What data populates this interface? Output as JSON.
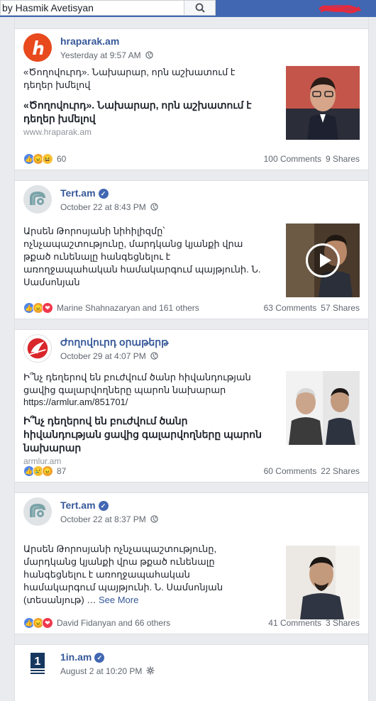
{
  "search": {
    "value": "by Hasmik Avetisyan"
  },
  "icons": {
    "search": "search-icon",
    "globe": "globe-icon",
    "gear": "gear-icon",
    "verified": "verified-check-icon",
    "play": "play-icon"
  },
  "colors": {
    "brand_blue": "#4267b2",
    "link": "#365899",
    "background": "#e9ebee"
  },
  "posts": [
    {
      "page": "hraparak.am",
      "time": "Yesterday at 9:57 AM",
      "verified": false,
      "text": "«Ծողովուրդ». Նախարար, որն աշխատում է դեղեր խմելով",
      "link_title": "«Ծողովուրդ». Նախարար, որն աշխատում է դեղեր խմելով",
      "link_domain": "www.hraparak.am",
      "reactions_count": "60",
      "comments": "100 Comments",
      "shares": "9 Shares"
    },
    {
      "page": "Tert.am",
      "time": "October 22 at 8:43 PM",
      "verified": true,
      "text": "Արսեն Թորոսյանի նիհիլիզմը՝ ոչնչապաշտությունը, մարդկանց կյանքի վրա թքած ունենալը հանգեցնելու է առողջապահական համակարգում պայթյունի. Ն. Սամսոնյան",
      "reactions_text": "Marine Shahnazaryan and 161 others",
      "comments": "63 Comments",
      "shares": "57 Shares"
    },
    {
      "page": "Ժողովուրդ օրաթերթ",
      "time": "October 29 at 4:07 PM",
      "verified": false,
      "text": "Ի՞նչ դեղերով են բուժվում ծանր հիվանդության ցավից գալարվողները պարոն նախարար",
      "link_url": "https://armlur.am/851701/",
      "link_title": "Ի՞նչ դեղերով են բուժվում ծանր հիվանդության ցավից գալարվողները պարոն նախարար",
      "link_domain": "armlur.am",
      "reactions_count": "87",
      "comments": "60 Comments",
      "shares": "22 Shares"
    },
    {
      "page": "Tert.am",
      "time": "October 22 at 8:37 PM",
      "verified": true,
      "text": "Արսեն Թորոսյանի ոչնչապաշտությունը, մարդկանց կյանքի վրա թքած ունենալը հանգեցնելու է առողջապահական համակարգում պայթյունի. Ն. Սամսոնյան (տեսանյութ) …",
      "see_more": "See More",
      "reactions_text": "David Fidanyan and 66 others",
      "comments": "41 Comments",
      "shares": "3 Shares"
    },
    {
      "page": "1in.am",
      "time": "August 2 at 10:20 PM",
      "verified": true
    }
  ]
}
